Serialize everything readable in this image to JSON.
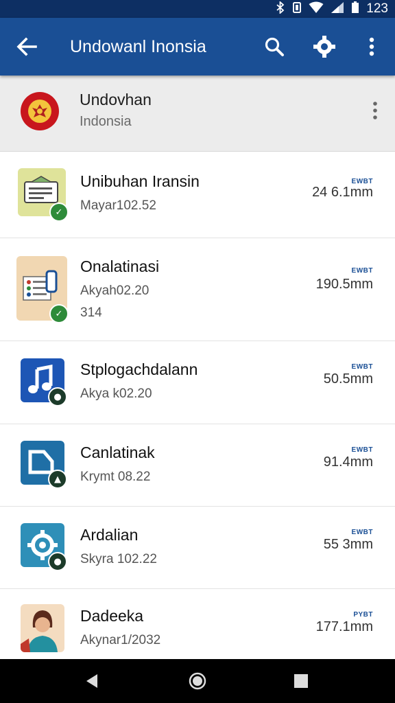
{
  "status": {
    "time": "123"
  },
  "appbar": {
    "title": "Undowanl Inonsia"
  },
  "header": {
    "title": "Undovhan",
    "subtitle": "Indonsia"
  },
  "items": [
    {
      "title": "Unibuhan Iransin",
      "line1": "Mayar102.52",
      "line2": "",
      "tag": "EWBT",
      "size": "24 6.1mm"
    },
    {
      "title": "Onalatinasi",
      "line1": "Akyah02.20",
      "line2": "314",
      "tag": "EWBT",
      "size": "190.5mm"
    },
    {
      "title": "Stplogachdalann",
      "line1": "Akya k02.20",
      "line2": "",
      "tag": "EWBT",
      "size": "50.5mm"
    },
    {
      "title": "Canlatinak",
      "line1": "Krymt 08.22",
      "line2": "",
      "tag": "EWBT",
      "size": "91.4mm"
    },
    {
      "title": "Ardalian",
      "line1": "Skyra 102.22",
      "line2": "",
      "tag": "EWBT",
      "size": "55 3mm"
    },
    {
      "title": "Dadeeka",
      "line1": "Akynar1/2032",
      "line2": "",
      "tag": "PYBT",
      "size": "177.1mm"
    }
  ],
  "colors": {
    "status_bar": "#0d2f63",
    "app_bar": "#1a4f95",
    "header_bg": "#ececec",
    "badge_green": "#2e8b3a"
  }
}
